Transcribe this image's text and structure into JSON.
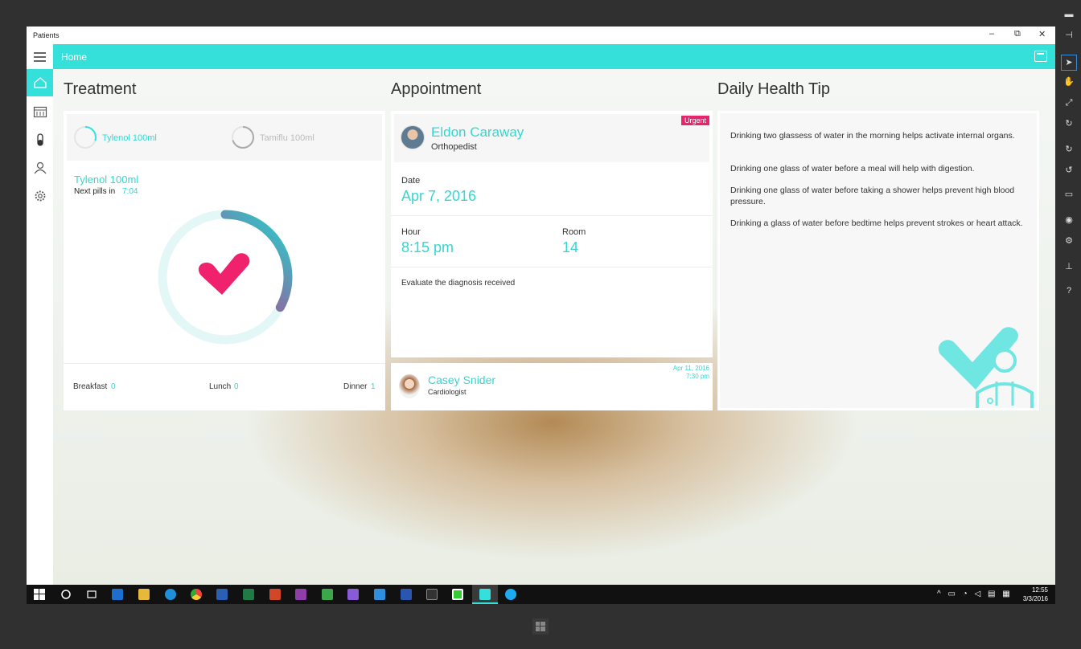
{
  "window": {
    "title": "Patients",
    "minimize": "–",
    "restore": "⧉",
    "close": "✕"
  },
  "appbar": {
    "title": "Home"
  },
  "sections": {
    "treatment": "Treatment",
    "appointment": "Appointment",
    "tip": "Daily Health Tip"
  },
  "treatment": {
    "pills": [
      {
        "name": "Tylenol 100ml",
        "progress": 0.3
      },
      {
        "name": "Tamiflu 100ml",
        "progress": 0.7
      }
    ],
    "current": {
      "name": "Tylenol 100ml",
      "next_label": "Next pills in",
      "next_time": "7:04",
      "progress": 0.33
    },
    "meals": [
      {
        "label": "Breakfast",
        "count": "0"
      },
      {
        "label": "Lunch",
        "count": "0"
      },
      {
        "label": "Dinner",
        "count": "1"
      }
    ]
  },
  "appointment": {
    "urgent_badge": "Urgent",
    "doctor": {
      "name": "Eldon Caraway",
      "specialty": "Orthopedist"
    },
    "date_label": "Date",
    "date": "Apr 7, 2016",
    "hour_label": "Hour",
    "hour": "8:15 pm",
    "room_label": "Room",
    "room": "14",
    "note": "Evaluate the diagnosis received",
    "next": {
      "name": "Casey Snider",
      "specialty": "Cardiologist",
      "date": "Apr 11, 2016",
      "time": "7:30 pm"
    }
  },
  "tips": [
    "Drinking two glassess of water in the morning helps activate internal organs.",
    "Drinking one glass of water before a meal will help with digestion.",
    "Drinking one glass of water before taking a shower helps prevent high blood pressure.",
    "Drinking a glass of water before bedtime helps prevent strokes or heart attack."
  ],
  "taskbar": {
    "time": "12:55",
    "date": "3/3/2016"
  },
  "colors": {
    "accent": "#35e0db",
    "pink": "#f0226e",
    "urgent": "#e8246e"
  }
}
